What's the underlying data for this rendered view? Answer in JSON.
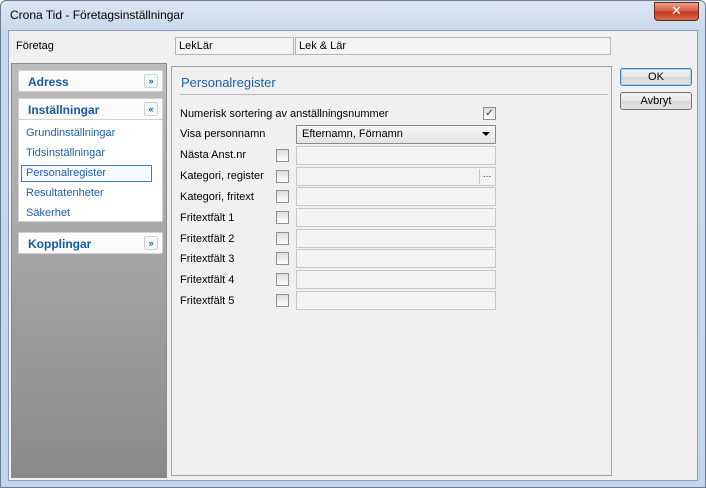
{
  "window": {
    "title": "Crona Tid - Företagsinställningar",
    "close_symbol": "✕"
  },
  "company": {
    "label": "Företag",
    "code": "LekLär",
    "name": "Lek & Lär"
  },
  "sidebar": {
    "adress": {
      "title": "Adress",
      "chevron": "»"
    },
    "installningar": {
      "title": "Inställningar",
      "chevron": "«",
      "items": [
        {
          "label": "Grundinställningar",
          "selected": false
        },
        {
          "label": "Tidsinställningar",
          "selected": false
        },
        {
          "label": "Personalregister",
          "selected": true
        },
        {
          "label": "Resultatenheter",
          "selected": false
        },
        {
          "label": "Säkerhet",
          "selected": false
        }
      ]
    },
    "kopplingar": {
      "title": "Kopplingar",
      "chevron": "»"
    }
  },
  "content": {
    "title": "Personalregister",
    "numeric_sort": {
      "label": "Numerisk sortering av anställningsnummer",
      "checked": true
    },
    "show_name": {
      "label": "Visa personnamn",
      "value": "Efternamn, Förnamn"
    },
    "fields": [
      {
        "label": "Nästa Anst.nr",
        "checked": false,
        "value": ""
      },
      {
        "label": "Kategori, register",
        "checked": false,
        "value": "",
        "browse": "..."
      },
      {
        "label": "Kategori, fritext",
        "checked": false,
        "value": ""
      },
      {
        "label": "Fritextfält 1",
        "checked": false,
        "value": ""
      },
      {
        "label": "Fritextfält 2",
        "checked": false,
        "value": ""
      },
      {
        "label": "Fritextfält 3",
        "checked": false,
        "value": ""
      },
      {
        "label": "Fritextfält 4",
        "checked": false,
        "value": ""
      },
      {
        "label": "Fritextfält 5",
        "checked": false,
        "value": ""
      }
    ]
  },
  "buttons": {
    "ok": "OK",
    "cancel": "Avbryt"
  },
  "colors": {
    "link_blue": "#1e5fad",
    "panel_title_blue": "#1559a8"
  }
}
